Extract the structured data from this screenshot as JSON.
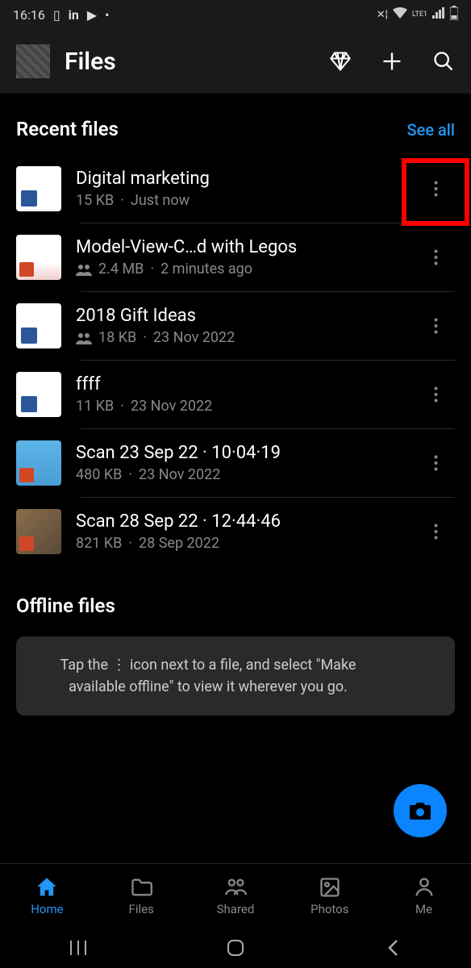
{
  "status": {
    "time": "16:16",
    "lte": "LTE1"
  },
  "header": {
    "title": "Files"
  },
  "recent": {
    "title": "Recent files",
    "see_all": "See all",
    "items": [
      {
        "name": "Digital marketing",
        "size": "15 KB",
        "sep": " · ",
        "date": "Just now",
        "shared": false
      },
      {
        "name": "Model-View-C…d with Legos",
        "size": "2.4 MB",
        "sep": " · ",
        "date": "2 minutes ago",
        "shared": true
      },
      {
        "name": "2018 Gift Ideas",
        "size": "18 KB",
        "sep": " · ",
        "date": "23 Nov 2022",
        "shared": true
      },
      {
        "name": "ffff",
        "size": "11 KB",
        "sep": " · ",
        "date": "23 Nov 2022",
        "shared": false
      },
      {
        "name": "Scan 23 Sep 22 · 10·04·19",
        "size": "480 KB",
        "sep": " · ",
        "date": "23 Nov 2022",
        "shared": false
      },
      {
        "name": "Scan 28 Sep 22 · 12·44·46",
        "size": "821 KB",
        "sep": " · ",
        "date": "28 Sep 2022",
        "shared": false
      }
    ]
  },
  "offline": {
    "title": "Offline files",
    "tip": "Tap the   ⋮   icon next to a file, and select \"Make available offline\" to view it wherever you go."
  },
  "nav": {
    "home": "Home",
    "files": "Files",
    "shared": "Shared",
    "photos": "Photos",
    "me": "Me"
  }
}
